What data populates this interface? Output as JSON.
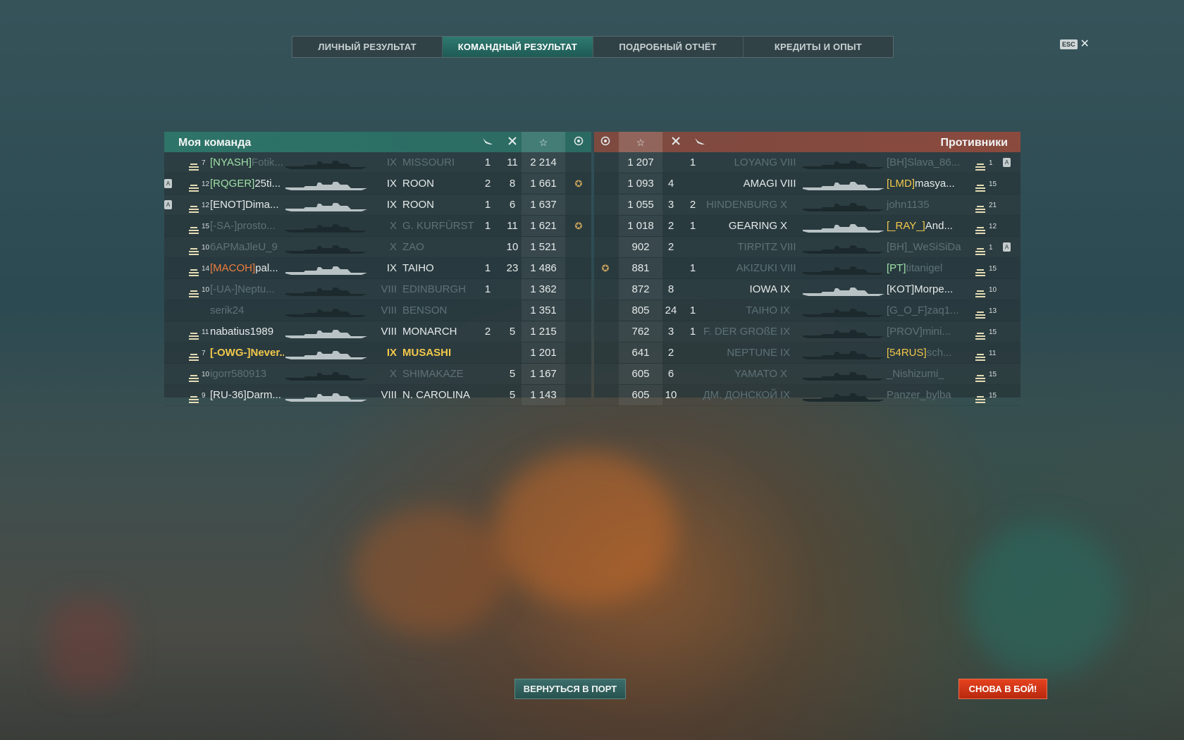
{
  "tabs": [
    "ЛИЧНЫЙ РЕЗУЛЬТАТ",
    "КОМАНДНЫЙ РЕЗУЛЬТАТ",
    "ПОДРОБНЫЙ ОТЧЁТ",
    "КРЕДИТЫ И ОПЫТ"
  ],
  "active_tab": "КОМАНДНЫЙ РЕЗУЛЬТАТ",
  "esc_label": "ESC",
  "close_glyph": "✕",
  "my_team": {
    "title": "Моя команда",
    "rows": [
      {
        "clan": "[NYASH]",
        "name": "Fotik...",
        "level": "7",
        "tier": "IX",
        "ship": "MISSOURI",
        "planes": "1",
        "kills": "11",
        "xp": "2 214",
        "ach": "",
        "badge": "",
        "dead": true,
        "clan_color": "green"
      },
      {
        "clan": "[RQGER]",
        "name": "25ti...",
        "level": "12",
        "tier": "IX",
        "ship": "ROON",
        "planes": "2",
        "kills": "8",
        "xp": "1 661",
        "ach": "✪",
        "badge": "A",
        "dead": false,
        "clan_color": "green"
      },
      {
        "clan": "[ENOT]",
        "name": "Dima...",
        "level": "12",
        "tier": "IX",
        "ship": "ROON",
        "planes": "1",
        "kills": "6",
        "xp": "1 637",
        "ach": "",
        "badge": "A",
        "dead": false,
        "clan_color": ""
      },
      {
        "clan": "[-SA-]",
        "name": "prosto...",
        "level": "15",
        "tier": "X",
        "ship": "G. KURFÜRST",
        "planes": "1",
        "kills": "11",
        "xp": "1 621",
        "ach": "✪",
        "badge": "",
        "dead": true,
        "clan_color": ""
      },
      {
        "clan": "",
        "name": "6APMaJleU_9",
        "level": "10",
        "tier": "X",
        "ship": "ZAO",
        "planes": "",
        "kills": "10",
        "xp": "1 521",
        "ach": "",
        "badge": "",
        "dead": true,
        "clan_color": ""
      },
      {
        "clan": "[MACOH]",
        "name": "pal...",
        "level": "14",
        "tier": "IX",
        "ship": "TAIHO",
        "planes": "1",
        "kills": "23",
        "xp": "1 486",
        "ach": "",
        "badge": "",
        "dead": false,
        "clan_color": "orange"
      },
      {
        "clan": "[-UA-]",
        "name": "Neptu...",
        "level": "10",
        "tier": "VIII",
        "ship": "EDINBURGH",
        "planes": "1",
        "kills": "",
        "xp": "1 362",
        "ach": "",
        "badge": "",
        "dead": true,
        "clan_color": ""
      },
      {
        "clan": "",
        "name": "serik24",
        "level": "",
        "tier": "VIII",
        "ship": "BENSON",
        "planes": "",
        "kills": "",
        "xp": "1 351",
        "ach": "",
        "badge": "",
        "dead": true,
        "clan_color": ""
      },
      {
        "clan": "",
        "name": "nabatius1989",
        "level": "11",
        "tier": "VIII",
        "ship": "MONARCH",
        "planes": "2",
        "kills": "5",
        "xp": "1 215",
        "ach": "",
        "badge": "",
        "dead": false,
        "clan_color": ""
      },
      {
        "clan": "[-OWG-]",
        "name": "Never...",
        "level": "7",
        "tier": "IX",
        "ship": "MUSASHI",
        "planes": "",
        "kills": "",
        "xp": "1 201",
        "ach": "",
        "badge": "",
        "dead": false,
        "me": true,
        "clan_color": "yellow"
      },
      {
        "clan": "",
        "name": "igorr580913",
        "level": "10",
        "tier": "X",
        "ship": "SHIMAKAZE",
        "planes": "",
        "kills": "5",
        "xp": "1 167",
        "ach": "",
        "badge": "",
        "dead": true,
        "clan_color": ""
      },
      {
        "clan": "[RU-36]",
        "name": "Darm...",
        "level": "9",
        "tier": "VIII",
        "ship": "N. CAROLINA",
        "planes": "",
        "kills": "5",
        "xp": "1 143",
        "ach": "",
        "badge": "",
        "dead": false,
        "clan_color": ""
      }
    ]
  },
  "enemies": {
    "title": "Противники",
    "rows": [
      {
        "clan": "[BH]",
        "name": "Slava_86...",
        "level": "1",
        "tier": "VIII",
        "ship": "LOYANG",
        "planes": "1",
        "kills": "",
        "xp": "1 207",
        "ach": "",
        "badge": "A",
        "dead": true,
        "clan_color": ""
      },
      {
        "clan": "[LMD]",
        "name": "masya...",
        "level": "15",
        "tier": "VIII",
        "ship": "AMAGI",
        "planes": "",
        "kills": "4",
        "xp": "1 093",
        "ach": "",
        "badge": "",
        "dead": false,
        "clan_color": "yellow"
      },
      {
        "clan": "",
        "name": "john1135",
        "level": "21",
        "tier": "X",
        "ship": "HINDENBURG",
        "planes": "2",
        "kills": "3",
        "xp": "1 055",
        "ach": "",
        "badge": "",
        "dead": true,
        "clan_color": ""
      },
      {
        "clan": "[_RAY_]",
        "name": "And...",
        "level": "12",
        "tier": "X",
        "ship": "GEARING",
        "planes": "1",
        "kills": "2",
        "xp": "1 018",
        "ach": "",
        "badge": "",
        "dead": false,
        "clan_color": "yellow"
      },
      {
        "clan": "[BH]",
        "name": "_WeSiSiDa",
        "level": "1",
        "tier": "VIII",
        "ship": "TIRPITZ",
        "planes": "",
        "kills": "2",
        "xp": "902",
        "ach": "",
        "badge": "A",
        "dead": true,
        "clan_color": ""
      },
      {
        "clan": "[PT]",
        "name": "titanigel",
        "level": "15",
        "tier": "VIII",
        "ship": "AKIZUKI",
        "planes": "1",
        "kills": "",
        "xp": "881",
        "ach": "✪",
        "badge": "",
        "dead": true,
        "clan_color": "green"
      },
      {
        "clan": "[KOT]",
        "name": "Morpe...",
        "level": "10",
        "tier": "IX",
        "ship": "IOWA",
        "planes": "",
        "kills": "8",
        "xp": "872",
        "ach": "",
        "badge": "",
        "dead": false,
        "clan_color": ""
      },
      {
        "clan": "[G_O_F]",
        "name": "zaq1...",
        "level": "13",
        "tier": "IX",
        "ship": "TAIHO",
        "planes": "1",
        "kills": "24",
        "xp": "805",
        "ach": "",
        "badge": "",
        "dead": true,
        "clan_color": ""
      },
      {
        "clan": "[PROV]",
        "name": "mini...",
        "level": "15",
        "tier": "IX",
        "ship": "F. DER GROßE",
        "planes": "1",
        "kills": "3",
        "xp": "762",
        "ach": "",
        "badge": "",
        "dead": true,
        "clan_color": ""
      },
      {
        "clan": "[54RUS]",
        "name": "sch...",
        "level": "11",
        "tier": "IX",
        "ship": "NEPTUNE",
        "planes": "",
        "kills": "2",
        "xp": "641",
        "ach": "",
        "badge": "",
        "dead": true,
        "clan_color": "yellow"
      },
      {
        "clan": "",
        "name": "_Nishizumi_",
        "level": "15",
        "tier": "X",
        "ship": "YAMATO",
        "planes": "",
        "kills": "6",
        "xp": "605",
        "ach": "",
        "badge": "",
        "dead": true,
        "clan_color": ""
      },
      {
        "clan": "",
        "name": "Panzer_bylba",
        "level": "15",
        "tier": "IX",
        "ship": "ДМ. ДОНСКОЙ",
        "planes": "",
        "kills": "10",
        "xp": "605",
        "ach": "",
        "badge": "",
        "dead": true,
        "clan_color": ""
      }
    ]
  },
  "buttons": {
    "return_port": "ВЕРНУТЬСЯ В ПОРТ",
    "battle_again": "СНОВА В БОЙ!"
  },
  "colors": {
    "team_header": "#2e7468",
    "enemy_header": "#8a4a3e",
    "highlight_player": "#f2c84b",
    "battle_button": "#d8391a"
  },
  "icons": {
    "planes": "plane-icon",
    "kills": "crossed-swords-icon",
    "xp": "star-icon",
    "achievement": "achievement-icon",
    "rank": "rank-chevrons-icon"
  }
}
